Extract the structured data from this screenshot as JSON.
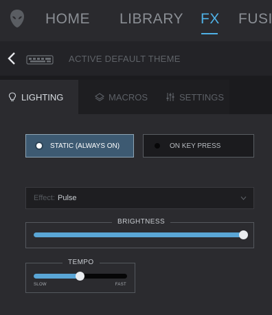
{
  "nav": {
    "items": [
      {
        "label": "HOME",
        "active": false
      },
      {
        "label": "LIBRARY",
        "active": false
      },
      {
        "label": "FX",
        "active": true
      },
      {
        "label": "FUSI",
        "active": false
      }
    ]
  },
  "subheader": {
    "title": "ACTIVE DEFAULT THEME"
  },
  "tabs": [
    {
      "label": "LIGHTING",
      "icon": "lightbulb-icon",
      "active": true
    },
    {
      "label": "MACROS",
      "icon": "layers-icon",
      "active": false
    },
    {
      "label": "SETTINGS",
      "icon": "sliders-icon",
      "active": false
    }
  ],
  "modes": {
    "static": "STATIC (ALWAYS ON)",
    "keypress": "ON KEY PRESS",
    "selected": "static"
  },
  "effect": {
    "label": "Effect:",
    "value": "Pulse"
  },
  "brightness": {
    "label": "BRIGHTNESS",
    "value": 1.0
  },
  "tempo": {
    "label": "TEMPO",
    "min_label": "SLOW",
    "max_label": "FAST",
    "value": 0.5
  },
  "colors": {
    "accent": "#4fb1e6",
    "slider_fill": "#5aa6d6",
    "selected_button": "#3d5a72"
  }
}
